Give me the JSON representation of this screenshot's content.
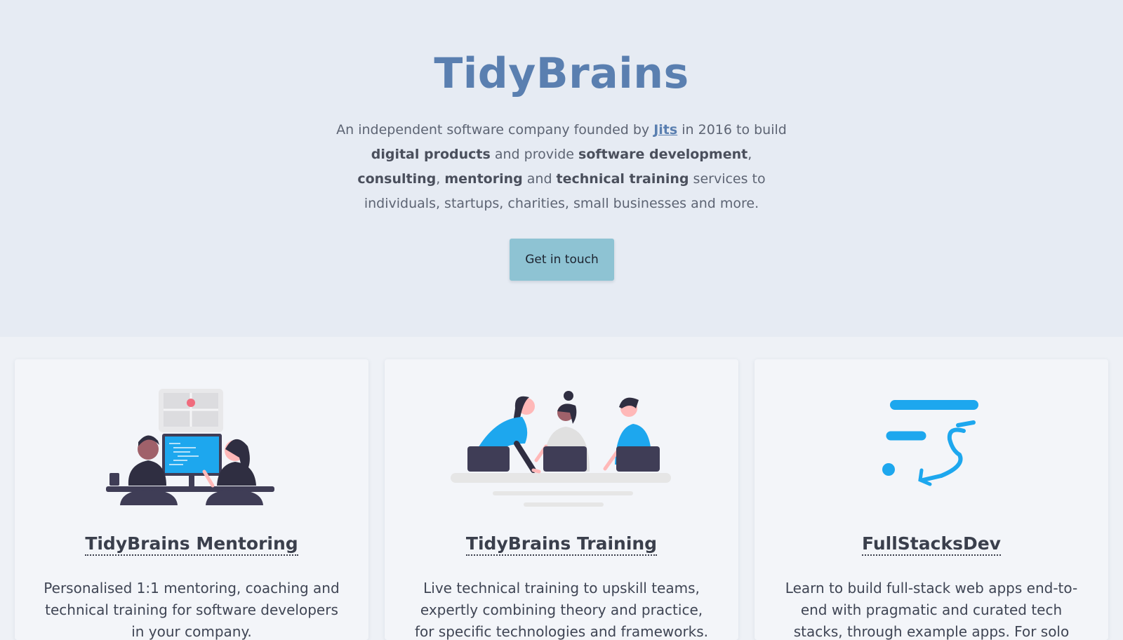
{
  "hero": {
    "title": "TidyBrains",
    "intro": {
      "t1": "An independent software company founded by ",
      "founder_link": "Jits",
      "t2": " in 2016 to build ",
      "b1": "digital products",
      "t3": " and provide ",
      "b2": "software development",
      "t4": ", ",
      "b3": "consulting",
      "t5": ", ",
      "b4": "mentoring",
      "t6": " and ",
      "b5": "technical training",
      "t7": " services to individuals, startups, charities, small businesses and more."
    },
    "cta_label": "Get in touch"
  },
  "cards": [
    {
      "title": "TidyBrains Mentoring",
      "description": "Personalised 1:1 mentoring, coaching and technical training for software developers in your company.",
      "illustration": "pair-programming-illustration"
    },
    {
      "title": "TidyBrains Training",
      "description": "Live technical training to upskill teams, expertly combining theory and practice, for specific technologies and frameworks.",
      "illustration": "team-training-illustration"
    },
    {
      "title": "FullStacksDev",
      "description": "Learn to build full-stack web apps end-to-end with pragmatic and curated tech stacks, through example apps. For solo devs and",
      "illustration": "fullstacksdev-logo"
    }
  ],
  "colors": {
    "brand": "#5a7fb0",
    "hero_bg": "#e6ebf3",
    "cta_bg": "#8ec3d3",
    "accent_blue": "#1da7ee"
  }
}
